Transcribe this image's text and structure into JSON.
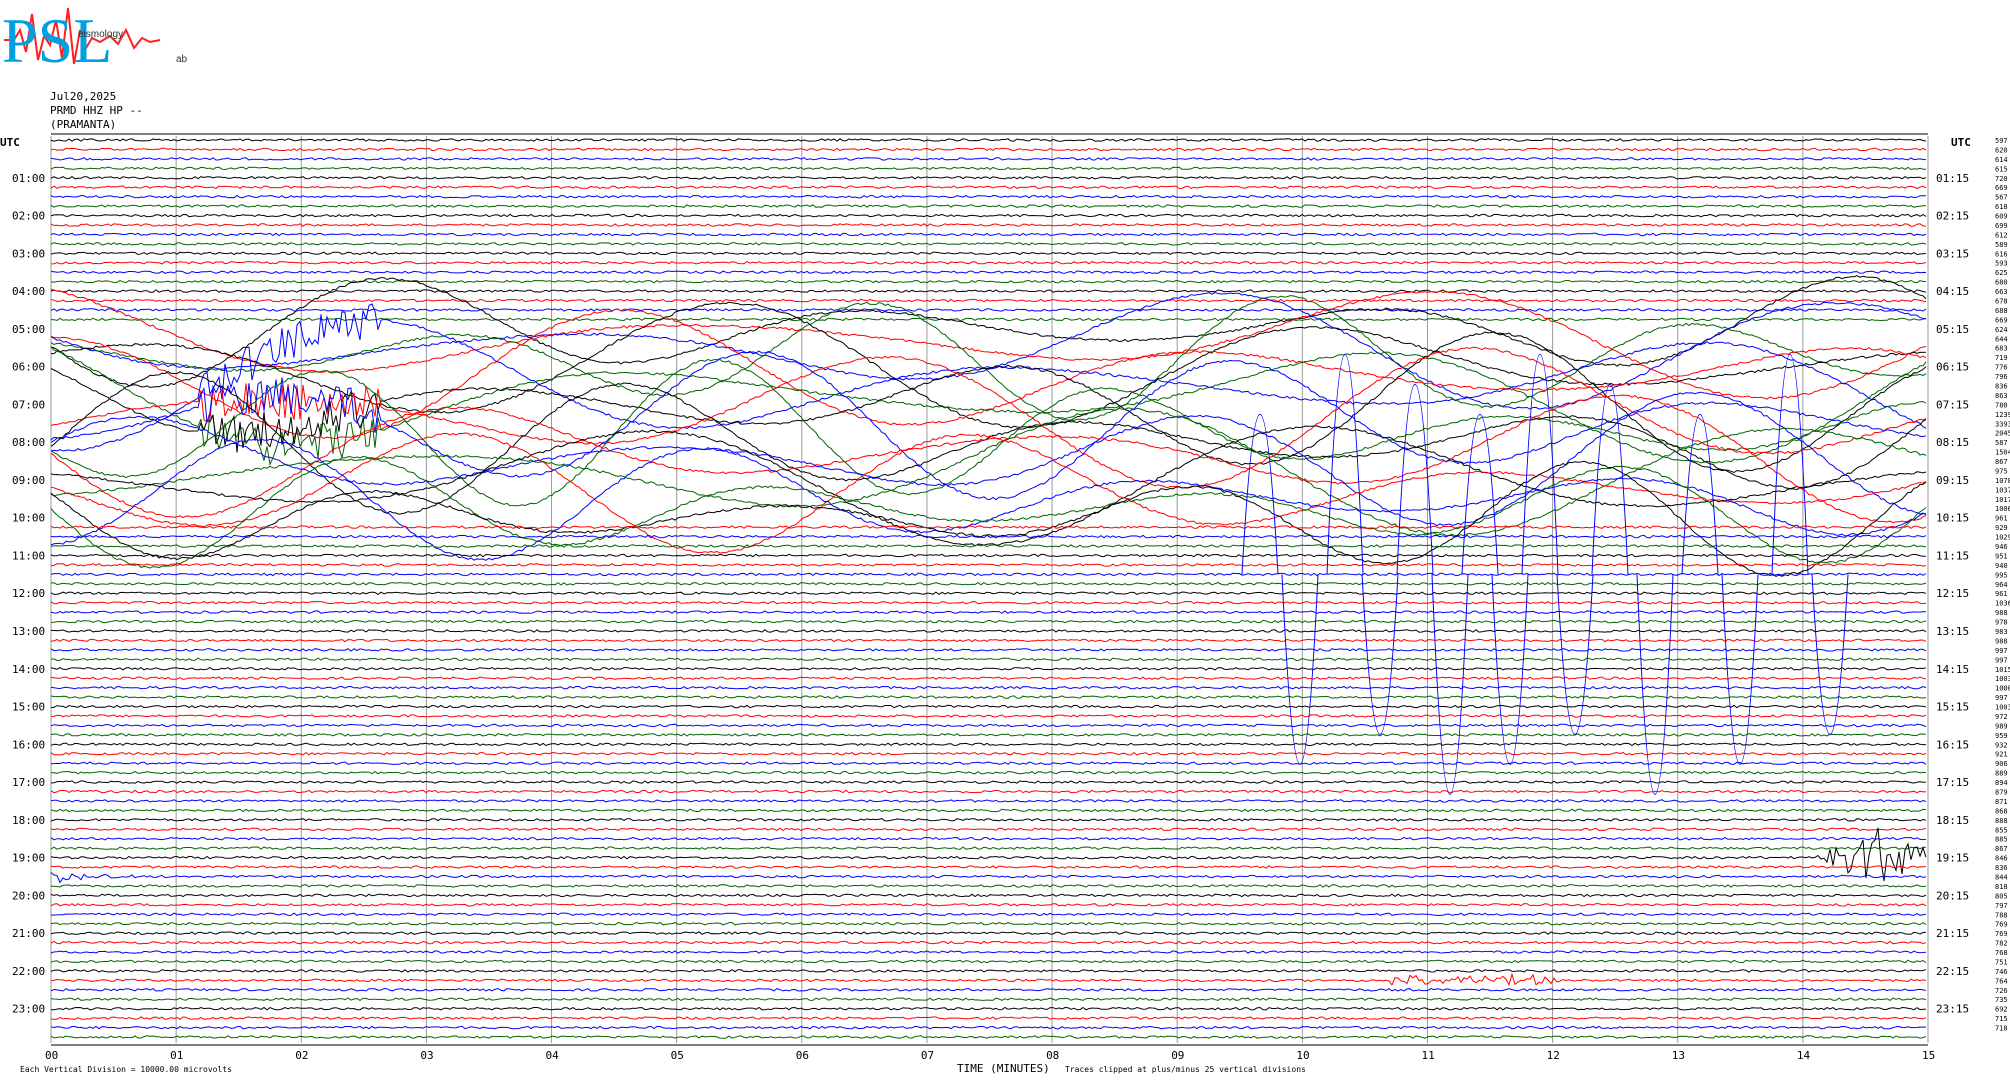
{
  "header": {
    "logo_big": "PSL",
    "logo_sub": "eismology",
    "logo_lab": "ab",
    "date": "Jul20,2025",
    "station": "PRMD HHZ HP --",
    "site": "(PRAMANTA)"
  },
  "chart_data": {
    "type": "line",
    "title": "",
    "left_axis_label": "UTC",
    "right_axis_label": "UTC",
    "xlabel": "TIME (MINUTES)",
    "xlim": [
      0,
      15
    ],
    "x_ticks": [
      "00",
      "01",
      "02",
      "03",
      "04",
      "05",
      "06",
      "07",
      "08",
      "09",
      "10",
      "11",
      "12",
      "13",
      "14",
      "15"
    ],
    "left_hour_labels": [
      "01:00",
      "02:00",
      "03:00",
      "04:00",
      "05:00",
      "06:00",
      "07:00",
      "08:00",
      "09:00",
      "10:00",
      "11:00",
      "12:00",
      "13:00",
      "14:00",
      "15:00",
      "16:00",
      "17:00",
      "18:00",
      "19:00",
      "20:00",
      "21:00",
      "22:00",
      "23:00"
    ],
    "right_hour_labels": [
      "01:15",
      "02:15",
      "03:15",
      "04:15",
      "05:15",
      "06:15",
      "07:15",
      "08:15",
      "09:15",
      "10:15",
      "11:15",
      "12:15",
      "13:15",
      "14:15",
      "15:15",
      "16:15",
      "17:15",
      "18:15",
      "19:15",
      "20:15",
      "21:15",
      "22:15",
      "23:15"
    ],
    "trace_colors": [
      "#000000",
      "#ff0000",
      "#0000ff",
      "#006400"
    ],
    "trace_count": 96,
    "trace_minutes": 15,
    "right_values": [
      "597",
      "620",
      "614",
      "615",
      "720",
      "669",
      "567",
      "618",
      "609",
      "699",
      "612",
      "589",
      "616",
      "593",
      "625",
      "680",
      "663",
      "678",
      "688",
      "669",
      "624",
      "644",
      "683",
      "719",
      "776",
      "796",
      "836",
      "863",
      "780",
      "1239",
      "3393",
      "2045",
      "587",
      "1504",
      "867",
      "975",
      "1078",
      "1037",
      "1017",
      "1006",
      "961",
      "929",
      "1029",
      "946",
      "951",
      "940",
      "995",
      "964",
      "961",
      "1036",
      "988",
      "978",
      "983",
      "988",
      "997",
      "997",
      "1015",
      "1003",
      "1000",
      "997",
      "1003",
      "972",
      "989",
      "959",
      "932",
      "921",
      "906",
      "889",
      "894",
      "879",
      "871",
      "868",
      "888",
      "855",
      "885",
      "867",
      "846",
      "836",
      "844",
      "818",
      "805",
      "797",
      "788",
      "769",
      "769",
      "782",
      "768",
      "751",
      "746",
      "764",
      "726",
      "735",
      "692",
      "715",
      "718"
    ],
    "footer_left": "Each Vertical Division = 10000.00 microvolts",
    "footer_right": "Traces clipped at plus/minus 25 vertical divisions",
    "logo_colors": {
      "letters": "#00a0e0",
      "trace": "#ff2020"
    }
  }
}
